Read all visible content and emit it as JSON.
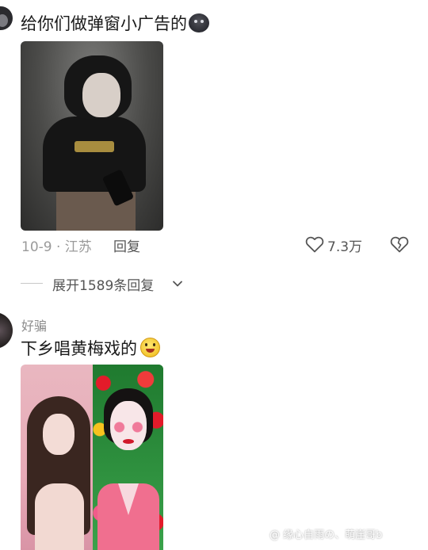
{
  "comment_1": {
    "text": "给你们做弹窗小广告的",
    "emoji": "dark-face-emoji",
    "date_location": "10-9 · 江苏",
    "reply_label": "回复",
    "likes": "7.3万",
    "expand_label": "展开1589条回复"
  },
  "comment_2": {
    "username": "好骗",
    "text": "下乡唱黄梅戏的",
    "emoji": "grinning-face-emoji"
  },
  "watermark": "@ 缘心自雨の、萌崖哥b",
  "colors": {
    "meta_gray": "#9a9a9a",
    "text_dark": "#1a1a1a",
    "photo2_left_bg": "#e7aab7",
    "photo2_right_bg": "#2f8d3a"
  }
}
